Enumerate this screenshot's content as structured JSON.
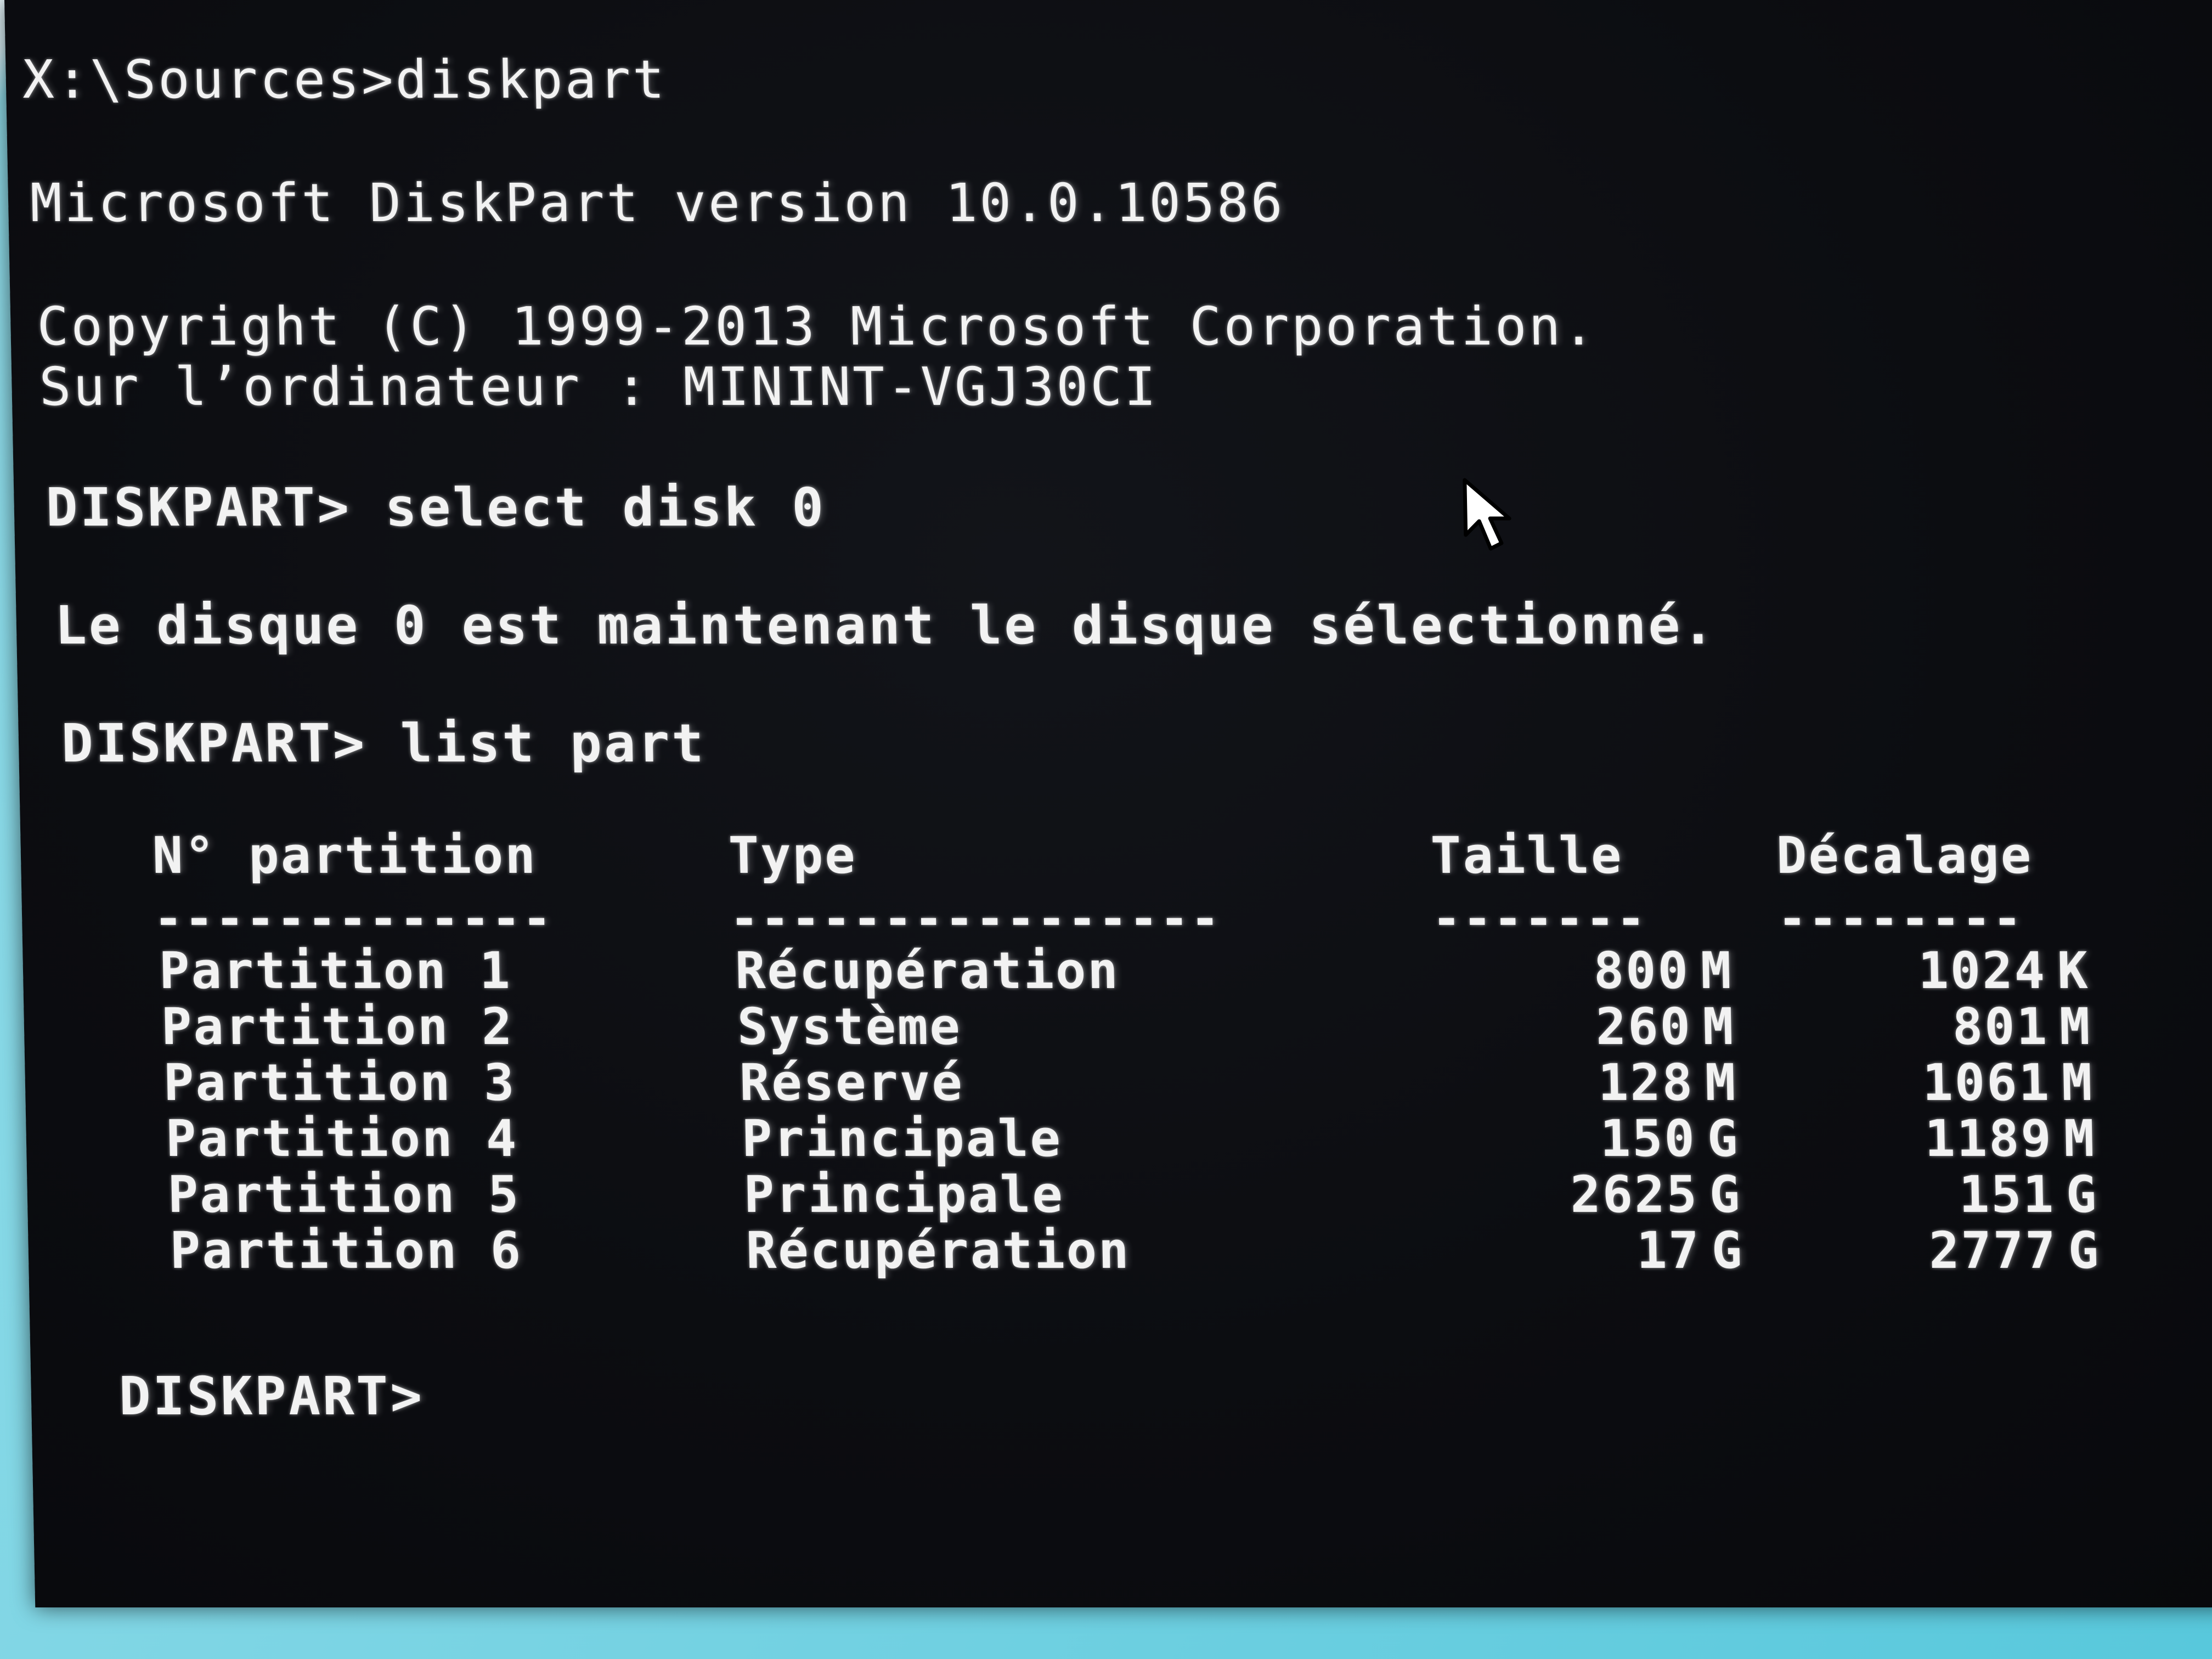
{
  "console": {
    "line1": "X:\\Sources>diskpart",
    "line2": "Microsoft DiskPart version 10.0.10586",
    "line3": "Copyright (C) 1999-2013 Microsoft Corporation.",
    "line4": "Sur l’ordinateur : MININT-VGJ30CI",
    "cmd1": "DISKPART> select disk 0",
    "msg1": "Le disque 0 est maintenant le disque sélectionné.",
    "cmd2": "DISKPART> list part",
    "prompt": "DISKPART>"
  },
  "table": {
    "headers": {
      "partition": "N° partition",
      "type": "Type",
      "size": "Taille",
      "offset": "Décalage"
    },
    "separators": {
      "partition": "-------------",
      "type": "----------------",
      "size": "-------",
      "offset": "--------"
    },
    "rows": [
      {
        "partition": "Partition 1",
        "type": "Récupération",
        "size": "800",
        "size_unit": "M",
        "offset": "1024",
        "offset_unit": "K"
      },
      {
        "partition": "Partition 2",
        "type": "Système",
        "size": "260",
        "size_unit": "M",
        "offset": "801",
        "offset_unit": "M"
      },
      {
        "partition": "Partition 3",
        "type": "Réservé",
        "size": "128",
        "size_unit": "M",
        "offset": "1061",
        "offset_unit": "M"
      },
      {
        "partition": "Partition 4",
        "type": "Principale",
        "size": "150",
        "size_unit": "G",
        "offset": "1189",
        "offset_unit": "M"
      },
      {
        "partition": "Partition 5",
        "type": "Principale",
        "size": "2625",
        "size_unit": "G",
        "offset": "151",
        "offset_unit": "G"
      },
      {
        "partition": "Partition 6",
        "type": "Récupération",
        "size": "17",
        "size_unit": "G",
        "offset": "2777",
        "offset_unit": "G"
      }
    ]
  },
  "colors": {
    "console_bg": "#0c0d11",
    "console_text": "#f2f2f2",
    "desktop_bg": "#6fd3e2"
  },
  "icons": {
    "cursor": "mouse-pointer-icon"
  }
}
